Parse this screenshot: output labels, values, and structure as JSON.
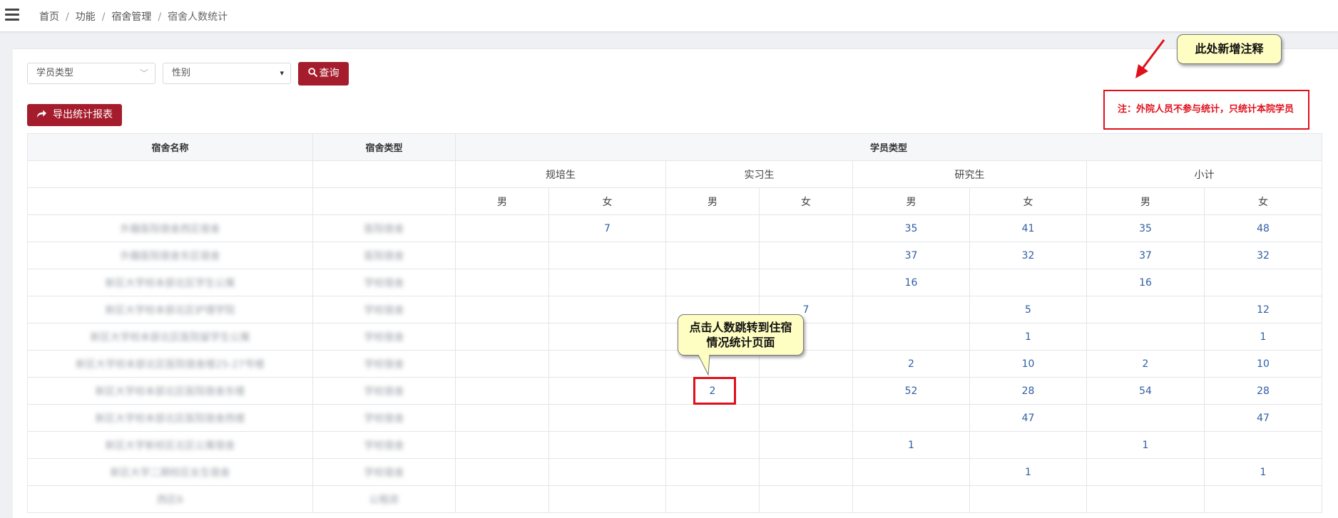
{
  "breadcrumb": [
    "首页",
    "功能",
    "宿舍管理",
    "宿舍人数统计"
  ],
  "filters": {
    "student_type_placeholder": "学员类型",
    "gender_placeholder": "性别",
    "query_label": "查询"
  },
  "export_label": "导出统计报表",
  "table": {
    "headers": {
      "dorm_name": "宿舍名称",
      "dorm_type": "宿舍类型",
      "student_type": "学员类型",
      "groups": [
        "规培生",
        "实习生",
        "研究生",
        "小计"
      ],
      "genders": [
        "男",
        "女",
        "男",
        "女",
        "男",
        "女",
        "男",
        "女"
      ]
    },
    "rows": [
      {
        "name": "外籍医院宿舍西区宿舍",
        "type": "医院宿舍",
        "cells": [
          "",
          "7",
          "",
          "",
          "35",
          "41",
          "35",
          "48"
        ]
      },
      {
        "name": "外籍医院宿舍东区宿舍",
        "type": "医院宿舍",
        "cells": [
          "",
          "",
          "",
          "",
          "37",
          "32",
          "37",
          "32"
        ]
      },
      {
        "name": "新区大学校本部北区学生公寓",
        "type": "学校宿舍",
        "cells": [
          "",
          "",
          "",
          "",
          "16",
          "",
          "16",
          ""
        ]
      },
      {
        "name": "新区大学校本部北区护理学院",
        "type": "学校宿舍",
        "cells": [
          "",
          "",
          "",
          "7",
          "",
          "5",
          "",
          "12"
        ]
      },
      {
        "name": "新区大学校本部北区医院留学生公寓",
        "type": "学校宿舍",
        "cells": [
          "",
          "",
          "",
          "",
          "",
          "1",
          "",
          "1"
        ]
      },
      {
        "name": "新区大学校本部北区医院宿舍楼25-27号楼",
        "type": "学校宿舍",
        "cells": [
          "",
          "",
          "",
          "",
          "2",
          "10",
          "2",
          "10"
        ]
      },
      {
        "name": "新区大学校本部北区医院宿舍东楼",
        "type": "学校宿舍",
        "cells": [
          "",
          "",
          "2",
          "",
          "52",
          "28",
          "54",
          "28"
        ]
      },
      {
        "name": "新区大学校本部北区医院宿舍西楼",
        "type": "学校宿舍",
        "cells": [
          "",
          "",
          "",
          "",
          "",
          "47",
          "",
          "47"
        ]
      },
      {
        "name": "新区大学新校区北区公寓宿舍",
        "type": "学校宿舍",
        "cells": [
          "",
          "",
          "",
          "",
          "1",
          "",
          "1",
          ""
        ]
      },
      {
        "name": "新区大学二期校区女生宿舍",
        "type": "学校宿舍",
        "cells": [
          "",
          "",
          "",
          "",
          "",
          "1",
          "",
          "1"
        ]
      },
      {
        "name": "西区6",
        "type": "公租房",
        "cells": [
          "",
          "",
          "",
          "",
          "",
          "",
          "",
          ""
        ]
      }
    ]
  },
  "annotations": {
    "new_note_bubble": "此处新增注释",
    "note_text": "注：外院人员不参与统计，只统计本院学员",
    "jump_bubble_line1": "点击人数跳转到住宿",
    "jump_bubble_line2": "情况统计页面"
  },
  "icons": {
    "menu": "hamburger-menu-icon",
    "query": "search-icon",
    "export": "share-arrow-icon"
  },
  "colors": {
    "primary": "#a51d2d",
    "link": "#2f5ea3",
    "annotation_red": "#e0101b",
    "bubble_yellow": "#fffec2"
  }
}
